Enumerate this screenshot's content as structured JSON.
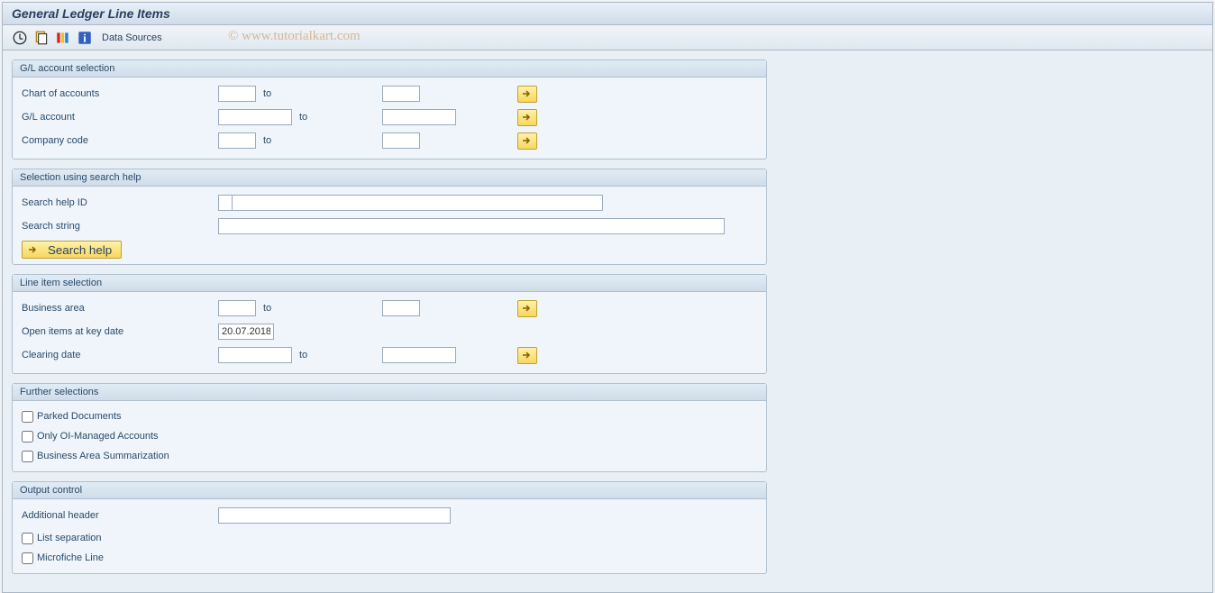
{
  "title": "General Ledger Line Items",
  "toolbar": {
    "data_sources": "Data Sources"
  },
  "watermark": "© www.tutorialkart.com",
  "groups": {
    "gl_select": {
      "title": "G/L account selection",
      "chart_of_accounts": "Chart of accounts",
      "gl_account": "G/L account",
      "company_code": "Company code",
      "to": "to"
    },
    "search_help_group": {
      "title": "Selection using search help",
      "search_help_id": "Search help ID",
      "search_string": "Search string",
      "search_help_btn": "Search help"
    },
    "line_item": {
      "title": "Line item selection",
      "business_area": "Business area",
      "open_items": "Open items at key date",
      "open_items_value": "20.07.2018",
      "clearing_date": "Clearing date",
      "to": "to"
    },
    "further": {
      "title": "Further selections",
      "parked": "Parked Documents",
      "oi_managed": "Only OI-Managed Accounts",
      "ba_summarization": "Business Area Summarization"
    },
    "output": {
      "title": "Output control",
      "additional_header": "Additional header",
      "list_separation": "List separation",
      "microfiche": "Microfiche Line"
    }
  }
}
